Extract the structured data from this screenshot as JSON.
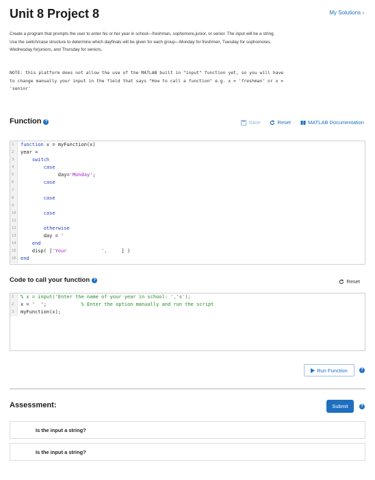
{
  "header": {
    "title": "Unit 8 Project 8",
    "my_solutions": "My Solutions ›"
  },
  "description": {
    "line1": "Create a program that prompts the user to enter his or her year in school—freshman, sophomore,junior, or senior. The input will be a string.",
    "line2": "Use the switch/case structure to determine which dayfinals will be given for each group—Monday for freshmen, Tuesday for sophomores,",
    "line3": "Wednesday forjuniors, and Thursday for seniors."
  },
  "note": {
    "line1": "NOTE: this platform does not allow the use of the MATLAB built in \"input\" function yet, so you will have",
    "line2": "to change manually your input in the field that says \"How to call a function\" e.g. x = 'freshman' or x =",
    "line3": "'senior'"
  },
  "function_section": {
    "heading": "Function",
    "save": "Save",
    "reset": "Reset",
    "docs": "MATLAB Documentation",
    "line_numbers": [
      "1",
      "2",
      "3",
      "4",
      "5",
      "6",
      "7",
      "8",
      "9",
      "10",
      "11",
      "12",
      "13",
      "14",
      "15",
      "16"
    ],
    "lines": {
      "l1_kw": "function",
      "l1_rest": " x = myFunction(x)",
      "l2": "year =",
      "l3": "switch",
      "l4": "case",
      "l5_a": "day=",
      "l5_str": "'Monday'",
      "l5_b": ";",
      "l6": "case",
      "l8": "case",
      "l10": "case",
      "l12": "otherwise",
      "l13_a": "day = ",
      "l13_str": "'",
      "l14": "end",
      "l15_a": "disp( [",
      "l15_str": "'Your",
      "l15_str2": "',",
      "l15_b": "] )",
      "l16": "end"
    }
  },
  "call_section": {
    "heading": "Code to call your function",
    "reset": "Reset",
    "line_numbers": [
      "1",
      "2",
      "3"
    ],
    "lines": {
      "l1": "% x = input('Enter the name of your year in school: ','s');",
      "l2_a": "x = '  ';",
      "l2_cmt": "% Enter the option manually and run the script",
      "l3": "myFunction(x);"
    }
  },
  "run_button": "Run Function",
  "assessment": {
    "heading": "Assessment:",
    "submit": "Submit",
    "items": [
      "Is the input a string?",
      "Is the input a string?"
    ]
  },
  "colors": {
    "accent": "#1e6fc0",
    "keyword": "#1d3fbf",
    "string": "#a020c0",
    "comment": "#228b22"
  }
}
